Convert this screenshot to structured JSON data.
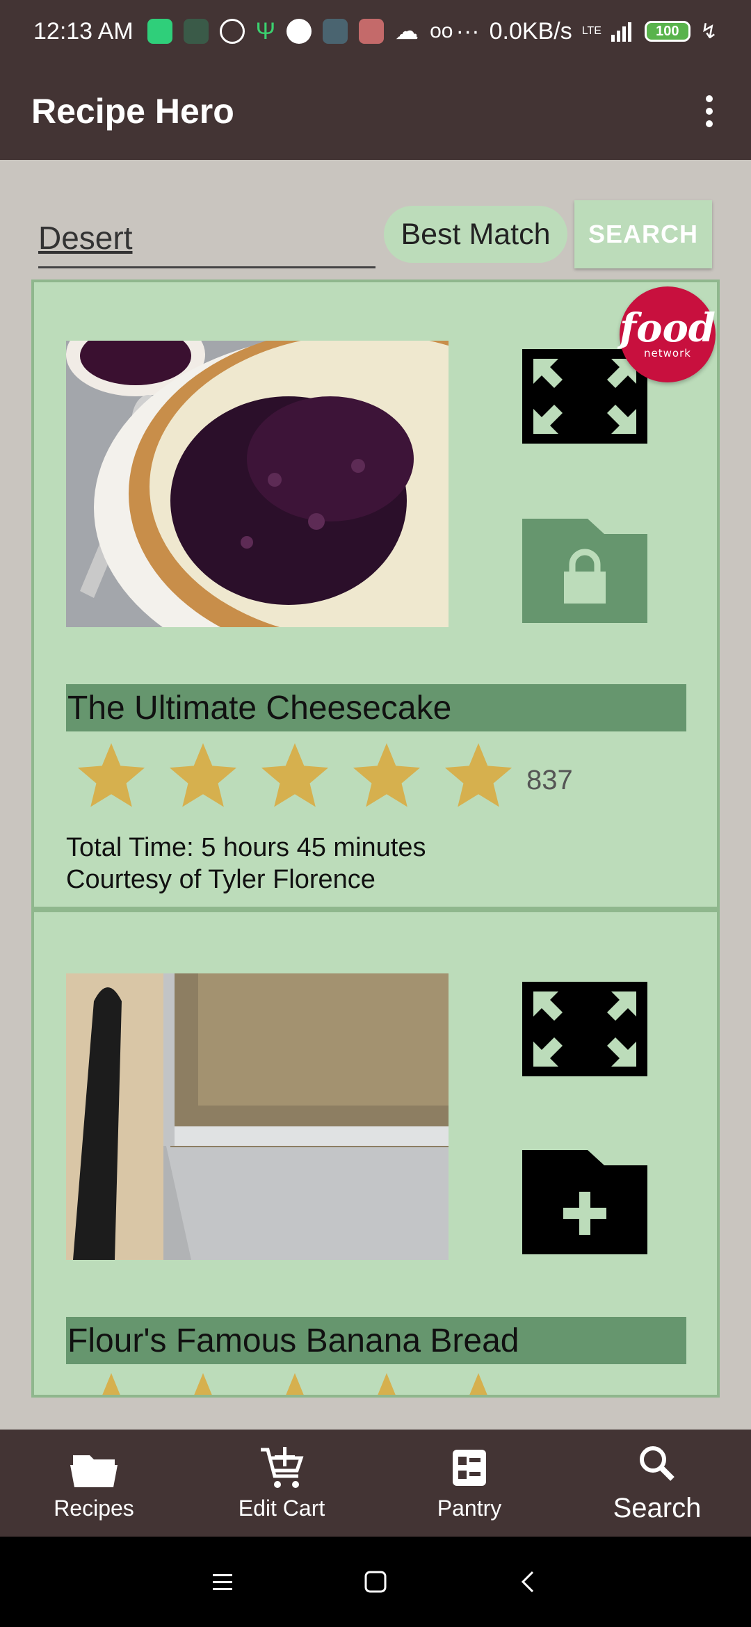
{
  "status_bar": {
    "time": "12:13 AM",
    "net_speed": "0.0KB/s",
    "network": "LTE",
    "battery": "100",
    "more": "···"
  },
  "app_bar": {
    "title": "Recipe Hero"
  },
  "search": {
    "query": "Desert",
    "sort_label": "Best Match",
    "button_label": "SEARCH"
  },
  "recipes": [
    {
      "title": "The Ultimate Cheesecake",
      "rating_stars": 5,
      "rating_count": "837",
      "total_time": "Total Time: 5 hours 45 minutes",
      "courtesy": "Courtesy of Tyler Florence",
      "source_logo_text": "food",
      "source_logo_sub": "network",
      "folder_state": "saved"
    },
    {
      "title": "Flour's Famous Banana Bread",
      "rating_stars": 5,
      "folder_state": "add"
    }
  ],
  "bottom_nav": [
    {
      "label": "Recipes",
      "icon": "folder-icon"
    },
    {
      "label": "Edit Cart",
      "icon": "cart-add-icon"
    },
    {
      "label": "Pantry",
      "icon": "pantry-icon"
    },
    {
      "label": "Search",
      "icon": "search-icon",
      "active": true
    }
  ],
  "colors": {
    "header": "#433434",
    "card_bg": "#bcdcba",
    "title_bar": "#66966e",
    "star": "#d6b04e"
  }
}
